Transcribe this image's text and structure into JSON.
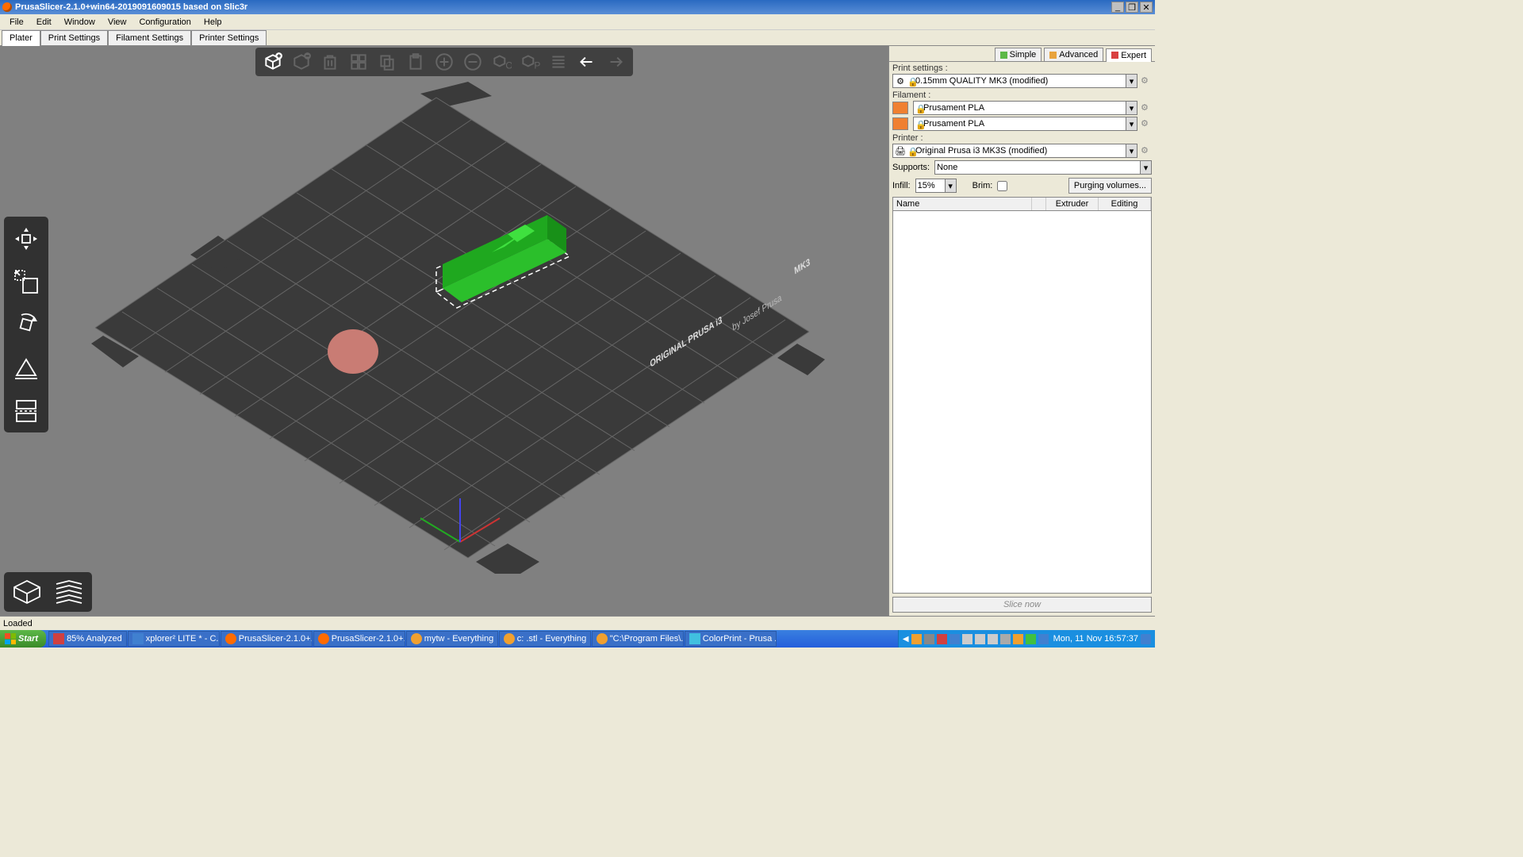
{
  "title": "PrusaSlicer-2.1.0+win64-2019091609015 based on Slic3r",
  "menu": [
    "File",
    "Edit",
    "Window",
    "View",
    "Configuration",
    "Help"
  ],
  "tabs": [
    "Plater",
    "Print Settings",
    "Filament Settings",
    "Printer Settings"
  ],
  "activeTab": 0,
  "modeTabs": [
    {
      "label": "Simple",
      "color": "#5cb848"
    },
    {
      "label": "Advanced",
      "color": "#e8a33d"
    },
    {
      "label": "Expert",
      "color": "#d94040"
    }
  ],
  "activeMode": 2,
  "right": {
    "printSettingsLabel": "Print settings :",
    "printSettings": "0.15mm QUALITY MK3 (modified)",
    "filamentLabel": "Filament :",
    "filaments": [
      "Prusament PLA",
      "Prusament PLA"
    ],
    "filamentColor": "#f08030",
    "printerLabel": "Printer :",
    "printer": "Original Prusa i3 MK3S (modified)",
    "supportsLabel": "Supports:",
    "supports": "None",
    "infillLabel": "Infill:",
    "infill": "15%",
    "brimLabel": "Brim:",
    "purgeBtn": "Purging volumes...",
    "cols": {
      "name": "Name",
      "extruder": "Extruder",
      "editing": "Editing"
    },
    "sliceBtn": "Slice now"
  },
  "bedText1": "ORIGINAL PRUSA i3",
  "bedText2": "MK3",
  "bedText3": "by Josef Prusa",
  "status": "Loaded",
  "taskbar": {
    "start": "Start",
    "tasks": [
      {
        "icon": "ai",
        "label": "85% Analyzed"
      },
      {
        "icon": "xp",
        "label": "xplorer² LITE * - C..."
      },
      {
        "icon": "ps",
        "label": "PrusaSlicer-2.1.0+..."
      },
      {
        "icon": "ps",
        "label": "PrusaSlicer-2.1.0+..."
      },
      {
        "icon": "ev",
        "label": "mytw - Everything"
      },
      {
        "icon": "ev",
        "label": "c: .stl - Everything"
      },
      {
        "icon": "ev",
        "label": "\"C:\\Program Files\\..."
      },
      {
        "icon": "cp",
        "label": "ColorPrint - Prusa ..."
      }
    ],
    "clock": "Mon, 11 Nov 16:57:37"
  }
}
